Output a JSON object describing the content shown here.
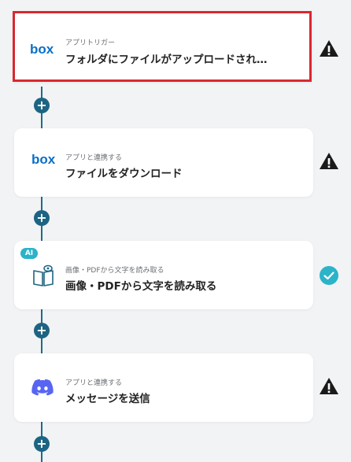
{
  "steps": [
    {
      "subtitle": "アプリトリガー",
      "title": "フォルダにファイルがアップロードされ…",
      "icon": "box-logo-icon",
      "status": "warning"
    },
    {
      "subtitle": "アプリと連携する",
      "title": "ファイルをダウンロード",
      "icon": "box-logo-icon",
      "status": "warning"
    },
    {
      "subtitle": "画像・PDFから文字を読み取る",
      "title": "画像・PDFから文字を読み取る",
      "icon": "ocr-book-icon",
      "status": "done",
      "badge": "AI"
    },
    {
      "subtitle": "アプリと連携する",
      "title": "メッセージを送信",
      "icon": "discord-logo-icon",
      "status": "warning"
    }
  ],
  "logo_text": "box",
  "plus_label": "+",
  "colors": {
    "accent": "#1d6483",
    "selected_border": "#d9282f",
    "box_blue": "#0a6fc7",
    "discord": "#5865f2",
    "done_teal": "#2bb3c9"
  }
}
